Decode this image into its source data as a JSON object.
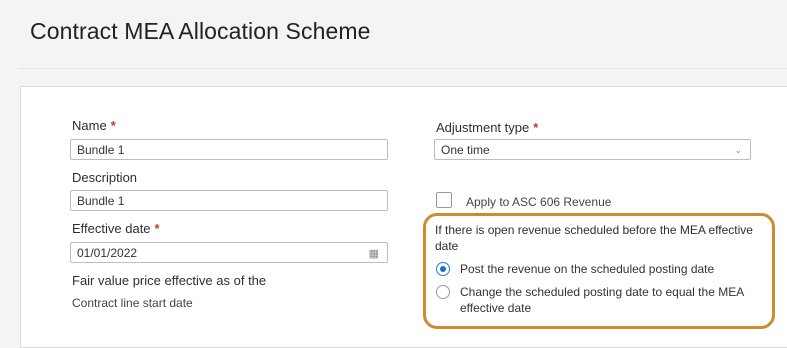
{
  "page": {
    "title": "Contract MEA Allocation Scheme"
  },
  "form": {
    "name": {
      "label": "Name",
      "required": "*",
      "value": "Bundle 1"
    },
    "description": {
      "label": "Description",
      "value": "Bundle 1"
    },
    "effective_date": {
      "label": "Effective date",
      "required": "*",
      "value": "01/01/2022",
      "icon": "calendar-icon"
    },
    "fair_value": {
      "label": "Fair value price effective as of the",
      "value": "Contract line start date"
    },
    "adjustment_type": {
      "label": "Adjustment type",
      "required": "*",
      "value": "One time",
      "icon": "chevron-down-icon"
    },
    "asc606": {
      "label": "Apply to ASC 606 Revenue",
      "checked": false
    },
    "open_revenue": {
      "label": "If there is open revenue scheduled before the MEA effective date",
      "options": [
        {
          "label": "Post the revenue on the scheduled posting date",
          "selected": true
        },
        {
          "label": "Change the scheduled posting date to equal the MEA effective date",
          "selected": false
        }
      ]
    }
  },
  "colors": {
    "required": "#c0392b",
    "highlight": "#d08a2f",
    "radio_selected": "#1f6fc4"
  }
}
